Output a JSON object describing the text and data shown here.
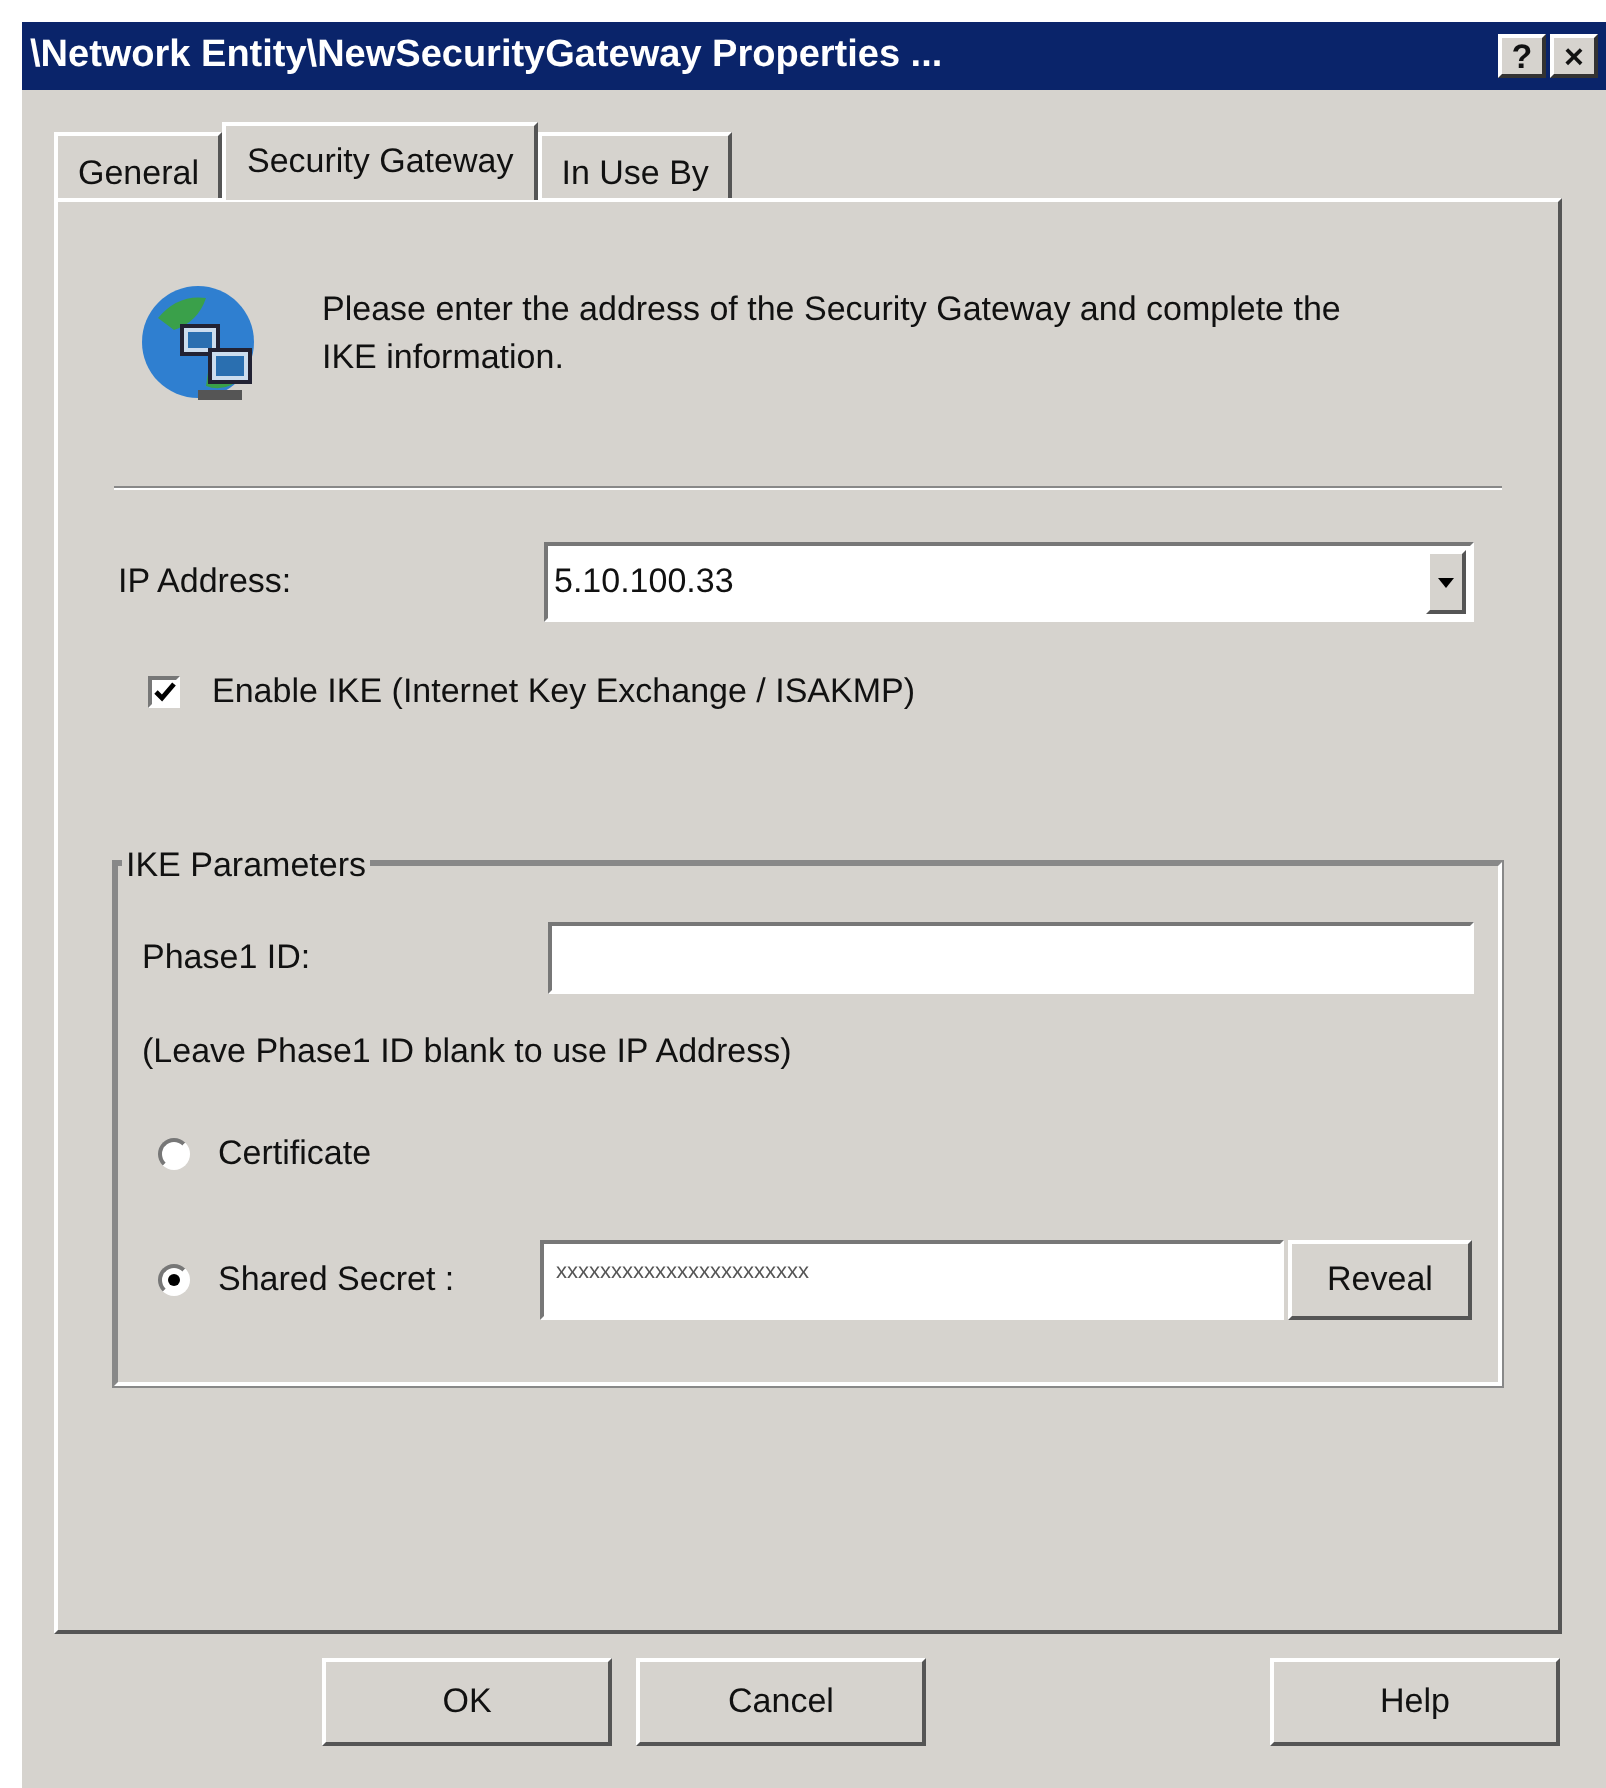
{
  "window": {
    "title": "\\Network Entity\\NewSecurityGateway Properties ...",
    "title_buttons": [
      "?",
      "×"
    ]
  },
  "tabs": [
    {
      "label": "General",
      "selected": false
    },
    {
      "label": "Security Gateway",
      "selected": true
    },
    {
      "label": "In Use By",
      "selected": false
    }
  ],
  "intro": "Please enter the address of the Security Gateway and complete the IKE information.",
  "ip_address": {
    "label": "IP Address:",
    "value": "5.10.100.33"
  },
  "enable_ike": {
    "label": "Enable IKE (Internet Key Exchange / ISAKMP)",
    "checked": true
  },
  "ike_parameters": {
    "title": "IKE Parameters",
    "phase1_id": {
      "label": "Phase1 ID:"
    },
    "note": "(Leave Phase1 ID blank to use IP Address)",
    "auth": [
      {
        "label": "Certificate",
        "selected": false
      },
      {
        "label": "Shared Secret :",
        "selected": true
      }
    ],
    "shared_secret": {
      "value": "xxxxxxxxxxxxxxxxxxxxxxx",
      "button": "Reveal"
    }
  },
  "buttons": [
    "OK",
    "Cancel",
    "Help"
  ]
}
